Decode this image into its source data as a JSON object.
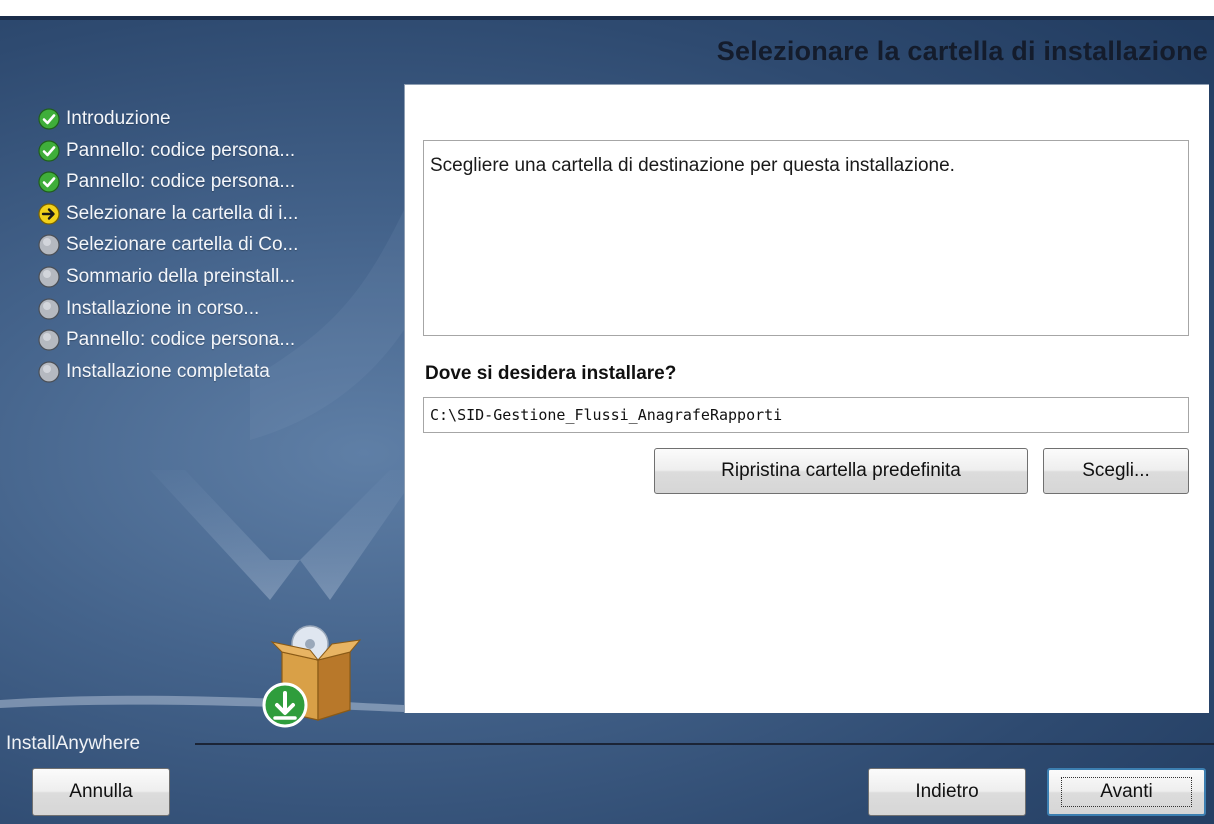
{
  "window": {
    "title": "Selezionare la cartella di installazione",
    "colors": {
      "background": "#3f5d85",
      "accent_border": "#3c7fb1",
      "panel": "#ffffff"
    }
  },
  "steps": [
    {
      "label": "Introduzione",
      "status": "completed",
      "icon": "check-icon"
    },
    {
      "label": "Pannello: codice persona...",
      "status": "completed",
      "icon": "check-icon"
    },
    {
      "label": "Pannello: codice persona...",
      "status": "completed",
      "icon": "check-icon"
    },
    {
      "label": "Selezionare la cartella di i...",
      "status": "current",
      "icon": "arrow-right-icon"
    },
    {
      "label": "Selezionare cartella di Co...",
      "status": "pending",
      "icon": "circle-icon"
    },
    {
      "label": "Sommario della preinstall...",
      "status": "pending",
      "icon": "circle-icon"
    },
    {
      "label": "Installazione in corso...",
      "status": "pending",
      "icon": "circle-icon"
    },
    {
      "label": "Pannello: codice persona...",
      "status": "pending",
      "icon": "circle-icon"
    },
    {
      "label": "Installazione completata",
      "status": "pending",
      "icon": "circle-icon"
    }
  ],
  "content": {
    "description": "Scegliere una cartella di destinazione per questa installazione.",
    "question": "Dove si desidera installare?",
    "install_path": "C:\\SID-Gestione_Flussi_AnagrafeRapporti",
    "restore_default_label": "Ripristina cartella predefinita",
    "choose_label": "Scegli..."
  },
  "footer": {
    "brand": "InstallAnywhere",
    "cancel_label": "Annulla",
    "back_label": "Indietro",
    "next_label": "Avanti"
  }
}
